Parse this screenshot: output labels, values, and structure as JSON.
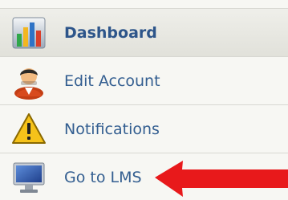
{
  "menu": {
    "items": [
      {
        "label": "Dashboard",
        "icon": "bar-chart-icon",
        "active": true
      },
      {
        "label": "Edit Account",
        "icon": "user-icon",
        "active": false
      },
      {
        "label": "Notifications",
        "icon": "warning-icon",
        "active": false
      },
      {
        "label": "Go to LMS",
        "icon": "monitor-icon",
        "active": false
      }
    ]
  },
  "annotation": {
    "arrow_color": "#e8191b",
    "points_to": "Go to LMS"
  },
  "colors": {
    "link": "#335e90",
    "active_background": "#e6e6df",
    "background": "#f7f7f3"
  }
}
